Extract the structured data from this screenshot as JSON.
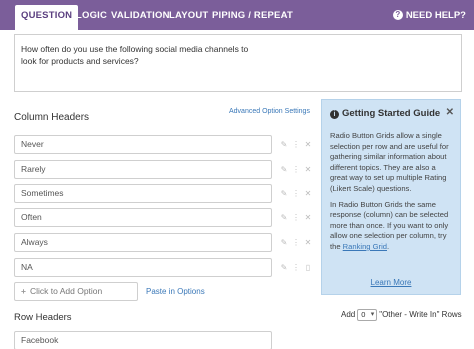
{
  "tabs": [
    {
      "label": "QUESTION",
      "active": true
    },
    {
      "label": "LOGIC",
      "active": false
    },
    {
      "label": "VALIDATION",
      "active": false
    },
    {
      "label": "LAYOUT",
      "active": false
    },
    {
      "label": "PIPING / REPEAT",
      "active": false
    }
  ],
  "help_label": "NEED HELP?",
  "question": {
    "text_line1": "How often do you use the following social media channels to",
    "text_line2": "look for products and services?"
  },
  "columns": {
    "title": "Column Headers",
    "advanced_link": "Advanced Option Settings",
    "options": [
      "Never",
      "Rarely",
      "Sometimes",
      "Often",
      "Always",
      "NA"
    ],
    "add_placeholder": "Click to Add Option",
    "paste_link": "Paste in Options"
  },
  "rows": {
    "title": "Row Headers",
    "options": [
      "Facebook"
    ]
  },
  "guide": {
    "title": "Getting Started Guide",
    "para1": "Radio Button Grids allow a single selection per row and are useful for gathering similar information about different topics. They are also a great way to set up multiple Rating (Likert Scale) questions.",
    "para2_prefix": "In Radio Button Grids the same response (column) can be selected more than once. If you want to only allow one selection per column, try the ",
    "para2_link": "Ranking Grid",
    "para2_suffix": ".",
    "learn_more": "Learn More"
  },
  "write_in": {
    "prefix": "Add",
    "count": "0",
    "suffix": "\"Other - Write In\" Rows"
  },
  "colors": {
    "topbar": "#7b5e9a",
    "guide_bg": "#cfe3f4",
    "link": "#3a78b8"
  }
}
